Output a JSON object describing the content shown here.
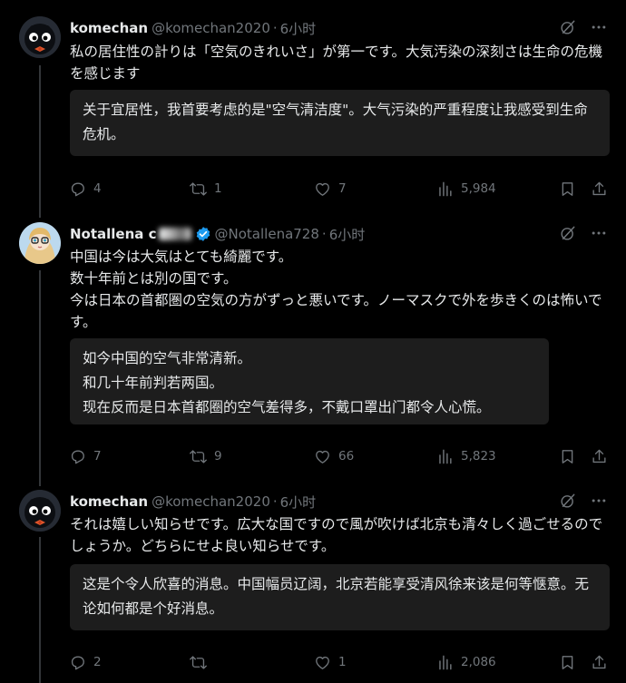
{
  "tweets": [
    {
      "name": "komechan",
      "handle": "@komechan2020",
      "time": "6小时",
      "text": "私の居住性の計りは「空気のきれいさ」が第一です。大気汚染の深刻さは生命の危機を感じます",
      "translation": "关于宜居性，我首要考虑的是\"空气清洁度\"。大气污染的严重程度让我感受到生命危机。",
      "replies": "4",
      "retweets": "1",
      "likes": "7",
      "views": "5,984"
    },
    {
      "name": "Notallena c",
      "handle": "@Notallena728",
      "time": "6小时",
      "text": "中国は今は大気はとても綺麗です。\n数十年前とは別の国です。\n今は日本の首都圏の空気の方がずっと悪いです。ノーマスクで外を歩きくのは怖いです。",
      "translation": "如今中国的空气非常清新。\n和几十年前判若两国。\n现在反而是日本首都圈的空气差得多，不戴口罩出门都令人心慌。",
      "replies": "7",
      "retweets": "9",
      "likes": "66",
      "views": "5,823"
    },
    {
      "name": "komechan",
      "handle": "@komechan2020",
      "time": "6小时",
      "text": "それは嬉しい知らせです。広大な国ですので風が吹けば北京も清々しく過ごせるのでしょうか。どちらにせよ良い知らせです。",
      "translation": "这是个令人欣喜的消息。中国幅员辽阔，北京若能享受清风徐来该是何等惬意。无论如何都是个好消息。",
      "replies": "2",
      "retweets": "",
      "likes": "1",
      "views": "2,086"
    }
  ],
  "icons": {
    "reply": "reply-icon",
    "retweet": "retweet-icon",
    "like": "heart-icon",
    "views": "views-icon",
    "bookmark": "bookmark-icon",
    "share": "share-icon",
    "grok": "grok-icon",
    "more": "more-icon",
    "verified": "verified-badge-icon"
  },
  "colors": {
    "background": "#000000",
    "text": "#e7e9ea",
    "muted": "#71767b",
    "translation_bg": "#1d1d1d",
    "verified": "#1d9bf0"
  }
}
